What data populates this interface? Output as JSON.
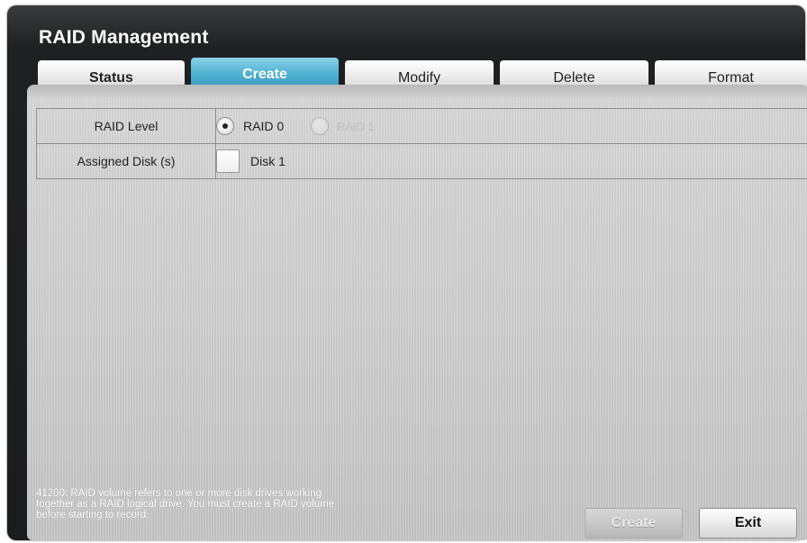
{
  "window": {
    "title": "RAID Management"
  },
  "tabs": [
    {
      "label": "Status"
    },
    {
      "label": "Create",
      "active": true
    },
    {
      "label": "Modify"
    },
    {
      "label": "Delete"
    },
    {
      "label": "Format"
    }
  ],
  "form": {
    "raid_level": {
      "label": "RAID Level",
      "options": [
        {
          "label": "RAID 0",
          "selected": true,
          "enabled": true
        },
        {
          "label": "RAID 1",
          "selected": false,
          "enabled": false
        }
      ]
    },
    "assigned_disks": {
      "label": "Assigned Disk (s)",
      "disk_label": "Disk 1",
      "checked": false
    }
  },
  "help_text_lines": [
    "41200: RAID volume refers to one or more disk drives working",
    "together as a RAID logical drive. You must create a RAID volume",
    "before starting to record."
  ],
  "buttons": {
    "create": "Create",
    "exit": "Exit",
    "create_enabled": false
  },
  "colors": {
    "active_tab": "#4fb1d2",
    "panel": "#c9c9c9",
    "frame": "#1f2022"
  }
}
